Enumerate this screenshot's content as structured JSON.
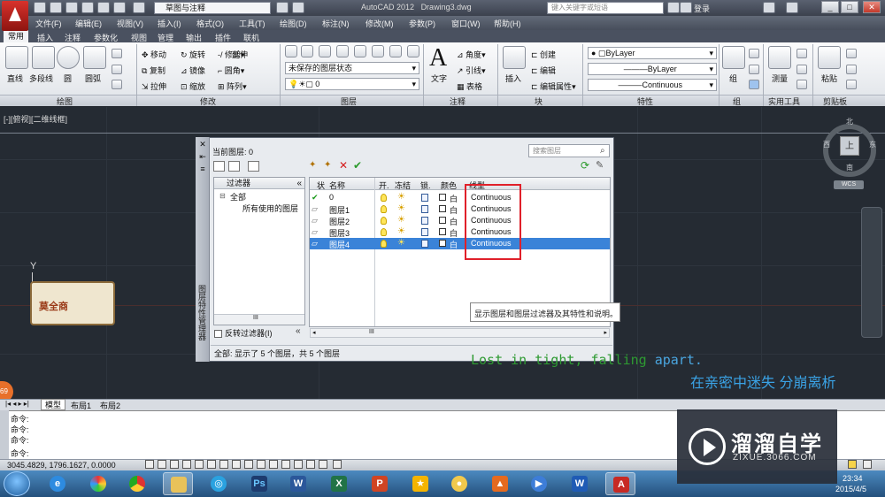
{
  "titlebar": {
    "workspace": "草图与注释",
    "app_name": "AutoCAD 2012",
    "document": "Drawing3.dwg",
    "search_placeholder": "键入关键字或短语",
    "login": "登录"
  },
  "menu": [
    "文件(F)",
    "编辑(E)",
    "视图(V)",
    "插入(I)",
    "格式(O)",
    "工具(T)",
    "绘图(D)",
    "标注(N)",
    "修改(M)",
    "参数(P)",
    "窗口(W)",
    "帮助(H)"
  ],
  "ribbon_tabs": [
    "常用",
    "插入",
    "注释",
    "参数化",
    "视图",
    "管理",
    "输出",
    "插件",
    "联机"
  ],
  "ribbon": {
    "draw": {
      "line": "直线",
      "polyline": "多段线",
      "circle": "圆",
      "arc": "圆弧",
      "panel_label": "绘图"
    },
    "modify": {
      "move": "移动",
      "rotate": "旋转",
      "trim": "修剪",
      "copy": "复制",
      "mirror": "镜像",
      "fillet": "圆角",
      "stretch": "拉伸",
      "scale": "缩放",
      "array": "阵列",
      "extend": "延伸",
      "panel_label": "修改"
    },
    "layers": {
      "unsaved_state": "未保存的图层状态",
      "current": "0",
      "panel_label": "图层"
    },
    "annotation": {
      "text": "文字",
      "angle": "角度",
      "leader": "引线",
      "table": "表格",
      "panel_label": "注释"
    },
    "block": {
      "insert": "插入",
      "create": "创建",
      "edit": "编辑",
      "edit_attributes": "编辑属性",
      "panel_label": "块"
    },
    "properties": {
      "color": "ByLayer",
      "lineweight": "ByLayer",
      "linetype": "Continuous",
      "panel_label": "特性"
    },
    "groups": {
      "group": "组",
      "panel_label": "组"
    },
    "utilities": {
      "measure": "测量",
      "panel_label": "实用工具"
    },
    "clipboard": {
      "paste": "粘贴",
      "panel_label": "剪贴板"
    }
  },
  "viewport_label": "[-][俯视][二维线框]",
  "ucs_label": "Y",
  "sticker_text": "莫全商",
  "viewcube": {
    "face": "上",
    "north": "北",
    "south": "南",
    "east": "东",
    "west": "西",
    "wcs": "WCS"
  },
  "layer_manager": {
    "palette_title": "图层特性管理器",
    "current_layer": "当前图层: 0",
    "search_placeholder": "搜索图层",
    "filters_header": "过滤器",
    "filter_all": "全部",
    "filter_used": "所有使用的图层",
    "invert_filter": "反转过滤器(I)",
    "columns": {
      "status": "状",
      "name": "名称",
      "on": "开.",
      "freeze": "冻结",
      "lock": "锁.",
      "color": "颜色",
      "linetype": "线型"
    },
    "layers": [
      {
        "name": "0",
        "color": "白",
        "linetype": "Continuous"
      },
      {
        "name": "图层1",
        "color": "白",
        "linetype": "Continuous"
      },
      {
        "name": "图层2",
        "color": "白",
        "linetype": "Continuous"
      },
      {
        "name": "图层3",
        "color": "白",
        "linetype": "Continuous"
      },
      {
        "name": "图层4",
        "color": "白",
        "linetype": "Continuous"
      }
    ],
    "tooltip": "显示图层和图层过滤器及其特性和说明。",
    "status": "全部: 显示了 5 个图层，共 5 个图层",
    "scroll_mark": "III"
  },
  "lyrics": {
    "en_main": "Lost in tight, falling",
    "en_tail": "apart.",
    "zh": "在亲密中迷失 分崩离析"
  },
  "layout_tabs": [
    "模型",
    "布局1",
    "布局2"
  ],
  "command_lines": [
    "命令:",
    "命令:",
    "命令:",
    "命令:"
  ],
  "coordinates": "3045.4829, 1796.1627, 0.0000",
  "badge": "69",
  "watermark": {
    "name": "溜溜自学",
    "url": "ZIXUE.3066.COM"
  },
  "clock": {
    "time": "23:34",
    "date": "2015/4/5"
  },
  "accent_colors": {
    "selection": "#3a83d8",
    "highlight_box": "#e0202a",
    "lyric_green": "#2e9a32",
    "lyric_blue": "#3aa3e6"
  }
}
